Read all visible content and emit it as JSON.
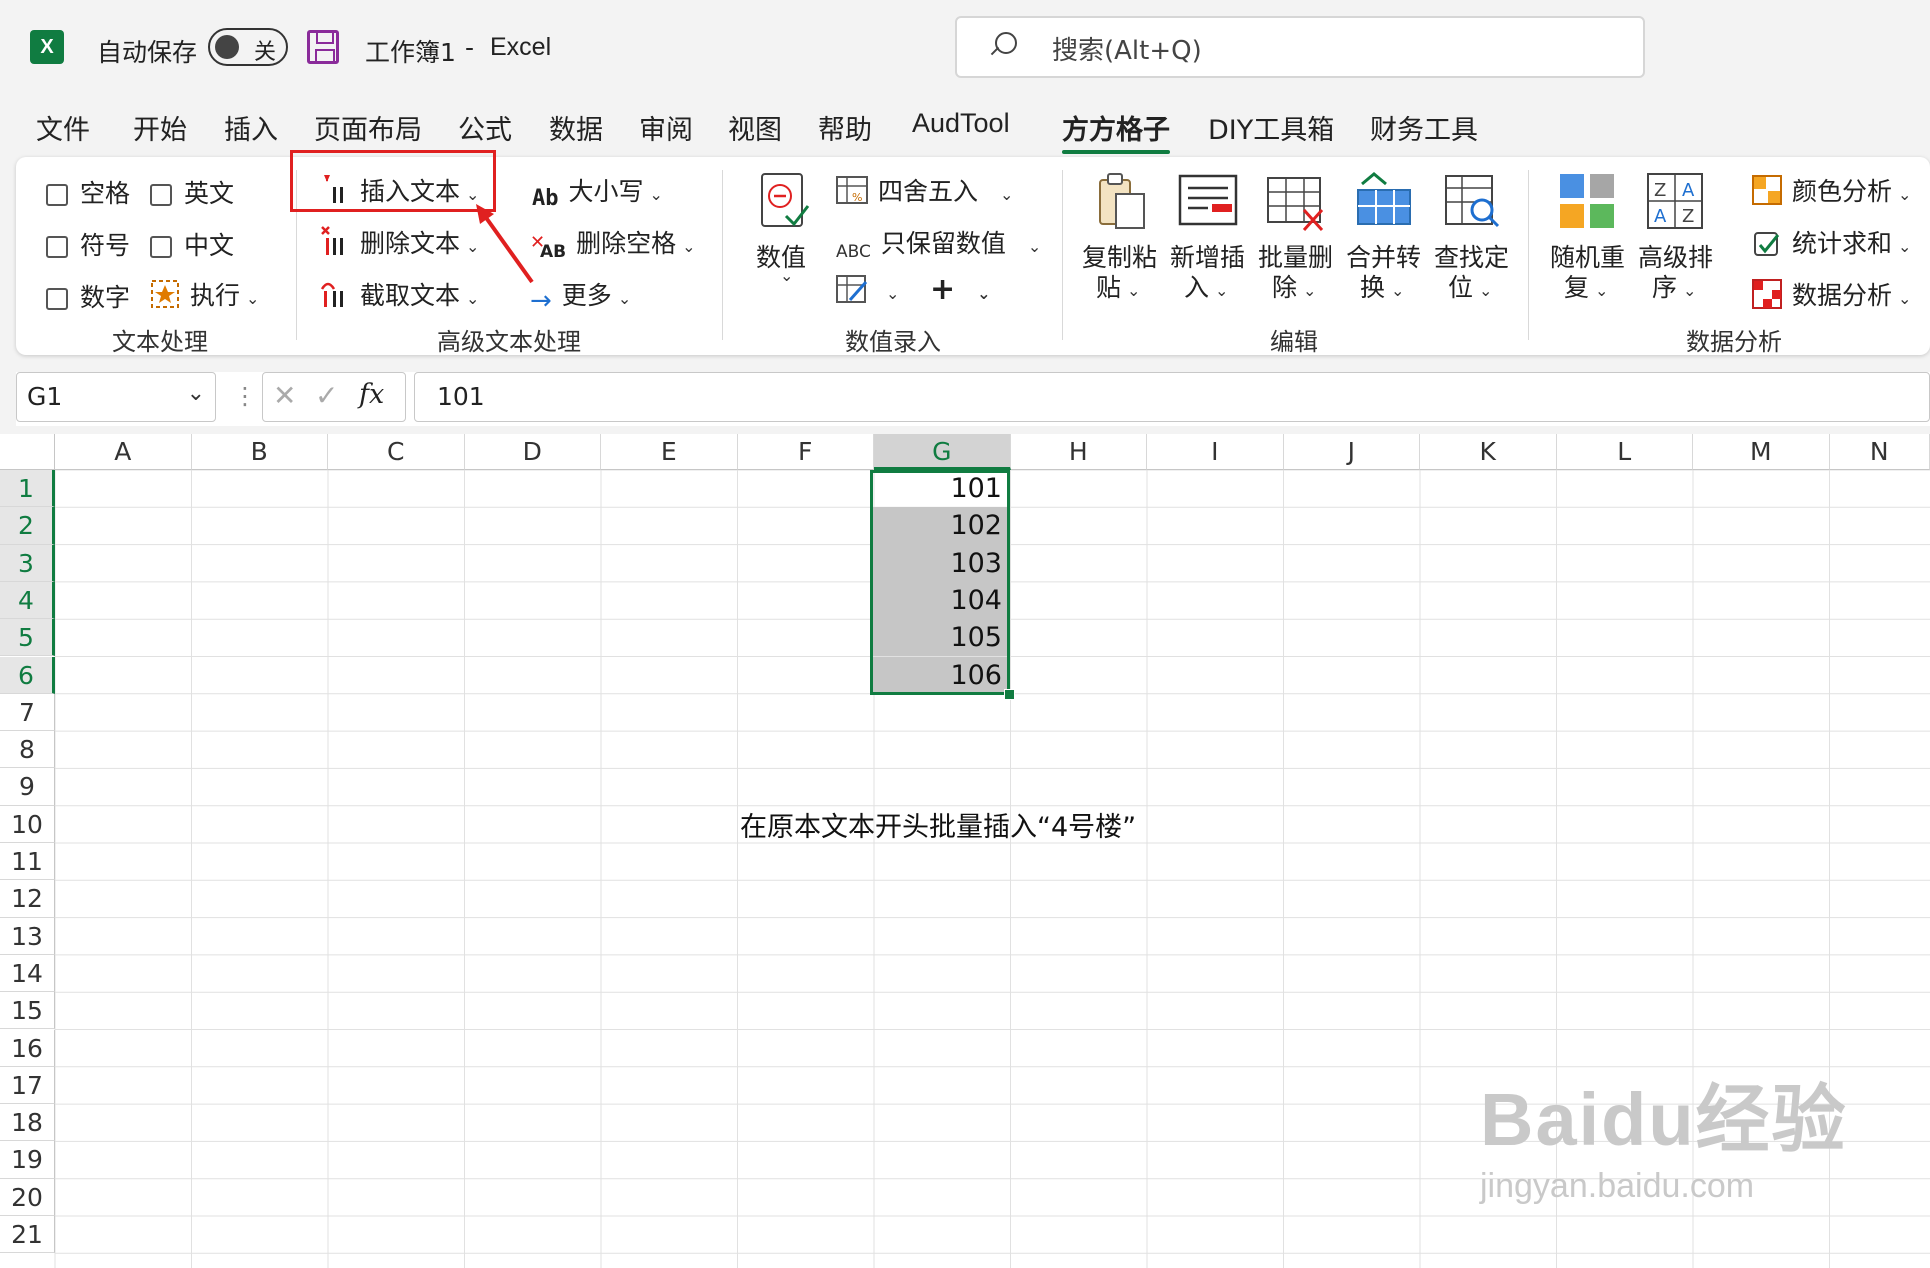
{
  "titlebar": {
    "logo": "X",
    "autosave_label": "自动保存",
    "toggle_state": "关",
    "workbook": "工作簿1",
    "separator": "-",
    "app": "Excel",
    "search_placeholder": "搜索(Alt+Q)"
  },
  "menu": [
    "文件",
    "开始",
    "插入",
    "页面布局",
    "公式",
    "数据",
    "审阅",
    "视图",
    "帮助",
    "AudTool",
    "方方格子",
    "DIY工具箱",
    "财务工具"
  ],
  "ribbon": {
    "text_processing": {
      "checkboxes": [
        "空格",
        "英文",
        "符号",
        "中文",
        "数字"
      ],
      "execute": "执行",
      "group_label": "文本处理"
    },
    "advanced_text": {
      "insert_text": "插入文本",
      "delete_text": "删除文本",
      "extract_text": "截取文本",
      "case": "大小写",
      "case_icon_text": "Ab",
      "delete_spaces": "删除空格",
      "delete_spaces_icon_text": "AB",
      "more": "更多",
      "group_label": "高级文本处理"
    },
    "numeric_entry": {
      "value_button": "数值",
      "round": "四舍五入",
      "keep_numeric": "只保留数值",
      "keep_numeric_icon_text": "ABC",
      "group_label": "数值录入"
    },
    "edit": {
      "buttons": [
        {
          "line1": "复制粘",
          "line2": "贴"
        },
        {
          "line1": "新增插",
          "line2": "入"
        },
        {
          "line1": "批量删",
          "line2": "除"
        },
        {
          "line1": "合并转",
          "line2": "换"
        },
        {
          "line1": "查找定",
          "line2": "位"
        }
      ],
      "group_label": "编辑"
    },
    "data_analysis": {
      "buttons": [
        {
          "line1": "随机重",
          "line2": "复"
        },
        {
          "line1": "高级排",
          "line2": "序"
        }
      ],
      "color_analysis": "颜色分析",
      "stat_sum": "统计求和",
      "data_analysis": "数据分析",
      "group_label": "数据分析"
    }
  },
  "formula_bar": {
    "name_box": "G1",
    "fx": "fx",
    "value": "101"
  },
  "sheet": {
    "columns": [
      "A",
      "B",
      "C",
      "D",
      "E",
      "F",
      "G",
      "H",
      "I",
      "J",
      "K",
      "L",
      "M",
      "N"
    ],
    "selected_column": "G",
    "rows": [
      "1",
      "2",
      "3",
      "4",
      "5",
      "6",
      "7",
      "8",
      "9",
      "10",
      "11",
      "12",
      "13",
      "14",
      "15",
      "16",
      "17",
      "18",
      "19",
      "20",
      "21"
    ],
    "g_values": [
      "101",
      "102",
      "103",
      "104",
      "105",
      "106"
    ],
    "note": "在原本文本开头批量插入“4号楼”"
  },
  "watermark": {
    "brand": "Baidu经验",
    "url": "jingyan.baidu.com"
  },
  "colors": {
    "excel_green": "#107c41",
    "highlight_red": "#e02020",
    "selection_gray": "#c6c6c6"
  }
}
